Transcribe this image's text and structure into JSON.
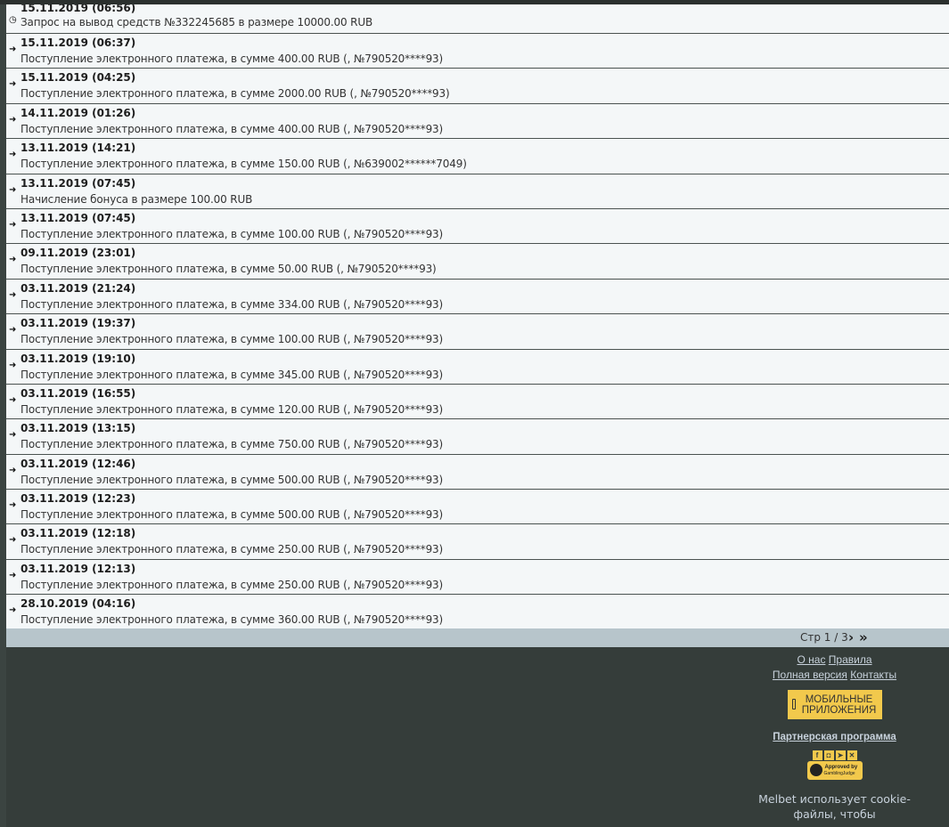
{
  "transactions": [
    {
      "date": "15.11.2019 (06:56)",
      "desc": "Запрос на вывод средств №332245685 в размере 10000.00 RUB",
      "icon": "clock-icon"
    },
    {
      "date": "15.11.2019 (06:37)",
      "desc": "Поступление электронного платежа, в сумме 400.00 RUB (, №790520****93)",
      "icon": "arrow-right-icon"
    },
    {
      "date": "15.11.2019 (04:25)",
      "desc": "Поступление электронного платежа, в сумме 2000.00 RUB (, №790520****93)",
      "icon": "arrow-right-icon"
    },
    {
      "date": "14.11.2019 (01:26)",
      "desc": "Поступление электронного платежа, в сумме 400.00 RUB (, №790520****93)",
      "icon": "arrow-right-icon"
    },
    {
      "date": "13.11.2019 (14:21)",
      "desc": "Поступление электронного платежа, в сумме 150.00 RUB (, №639002******7049)",
      "icon": "arrow-right-icon"
    },
    {
      "date": "13.11.2019 (07:45)",
      "desc": "Начисление бонуса в размере 100.00 RUB",
      "icon": "arrow-right-icon"
    },
    {
      "date": "13.11.2019 (07:45)",
      "desc": "Поступление электронного платежа, в сумме 100.00 RUB (, №790520****93)",
      "icon": "arrow-right-icon"
    },
    {
      "date": "09.11.2019 (23:01)",
      "desc": "Поступление электронного платежа, в сумме 50.00 RUB (, №790520****93)",
      "icon": "arrow-right-icon"
    },
    {
      "date": "03.11.2019 (21:24)",
      "desc": "Поступление электронного платежа, в сумме 334.00 RUB (, №790520****93)",
      "icon": "arrow-right-icon"
    },
    {
      "date": "03.11.2019 (19:37)",
      "desc": "Поступление электронного платежа, в сумме 100.00 RUB (, №790520****93)",
      "icon": "arrow-right-icon"
    },
    {
      "date": "03.11.2019 (19:10)",
      "desc": "Поступление электронного платежа, в сумме 345.00 RUB (, №790520****93)",
      "icon": "arrow-right-icon"
    },
    {
      "date": "03.11.2019 (16:55)",
      "desc": "Поступление электронного платежа, в сумме 120.00 RUB (, №790520****93)",
      "icon": "arrow-right-icon"
    },
    {
      "date": "03.11.2019 (13:15)",
      "desc": "Поступление электронного платежа, в сумме 750.00 RUB (, №790520****93)",
      "icon": "arrow-right-icon"
    },
    {
      "date": "03.11.2019 (12:46)",
      "desc": "Поступление электронного платежа, в сумме 500.00 RUB (, №790520****93)",
      "icon": "arrow-right-icon"
    },
    {
      "date": "03.11.2019 (12:23)",
      "desc": "Поступление электронного платежа, в сумме 500.00 RUB (, №790520****93)",
      "icon": "arrow-right-icon"
    },
    {
      "date": "03.11.2019 (12:18)",
      "desc": "Поступление электронного платежа, в сумме 250.00 RUB (, №790520****93)",
      "icon": "arrow-right-icon"
    },
    {
      "date": "03.11.2019 (12:13)",
      "desc": "Поступление электронного платежа, в сумме 250.00 RUB (, №790520****93)",
      "icon": "arrow-right-icon"
    },
    {
      "date": "28.10.2019 (04:16)",
      "desc": "Поступление электронного платежа, в сумме 360.00 RUB (, №790520****93)",
      "icon": "arrow-right-icon"
    }
  ],
  "pager": {
    "label": "Стр 1 / 3",
    "next_icon": "chevron-right-icon",
    "last_icon": "double-chevron-right-icon"
  },
  "footer": {
    "about": "О нас",
    "rules": "Правила",
    "full_version": "Полная версия",
    "contacts": "Контакты",
    "mobile_line1": "МОБИЛЬНЫЕ",
    "mobile_line2": "ПРИЛОЖЕНИЯ",
    "partner": "Партнерская программа",
    "approved_line1": "Approved by",
    "approved_line2": "GamblingJudge",
    "cookie_text": "Melbet использует cookie-файлы, чтобы гарантировать вам"
  },
  "colors": {
    "accent": "#f2c94c",
    "footer_bg": "#353d3a",
    "list_bg": "#f4f7f8",
    "pager_bg": "#b7c5cb",
    "link": "#c8d2dc"
  }
}
